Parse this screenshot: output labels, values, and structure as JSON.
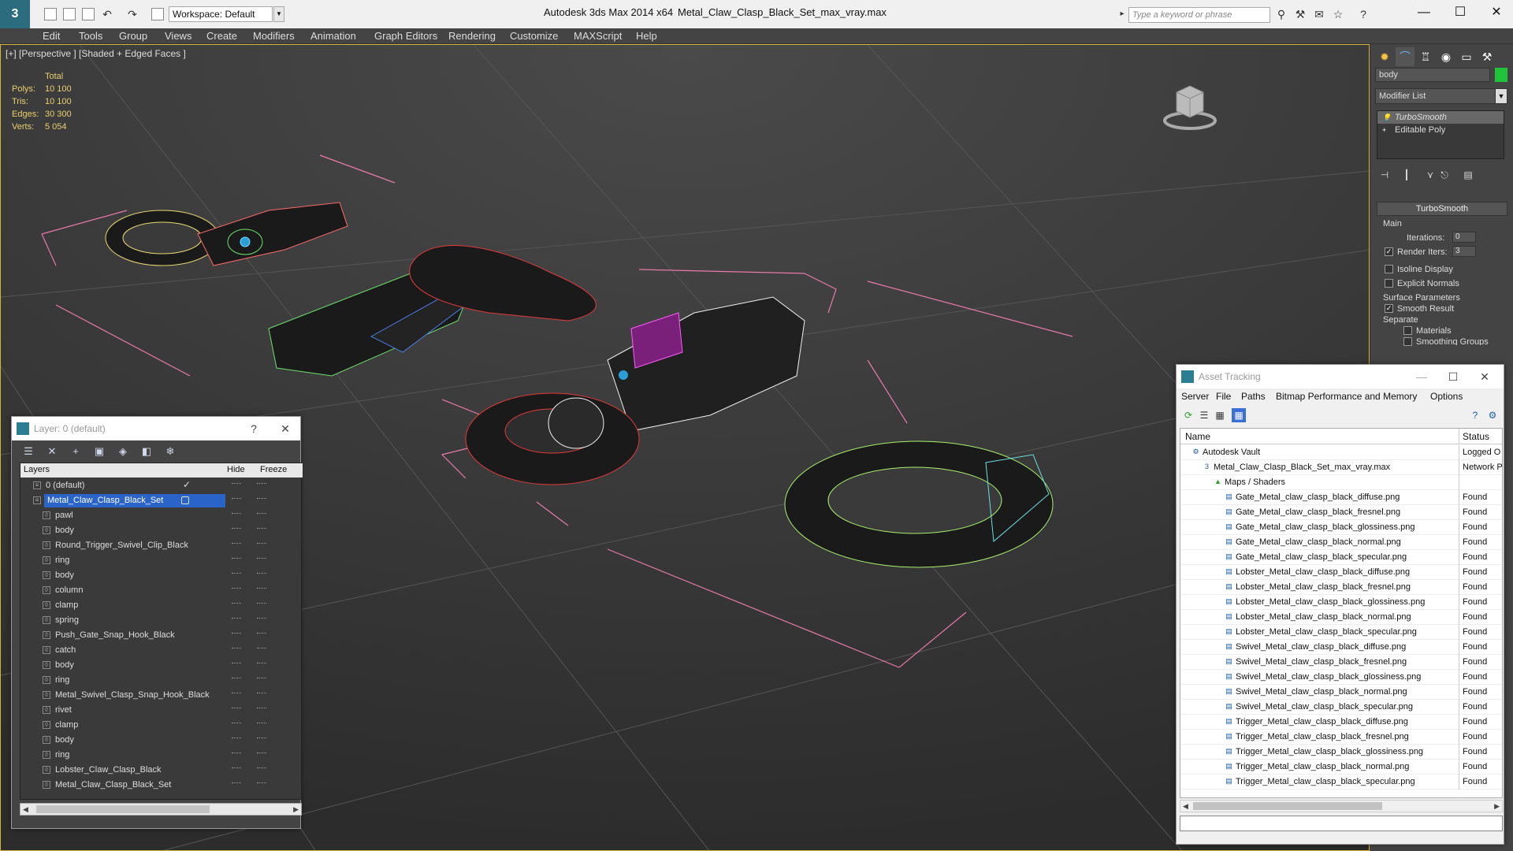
{
  "titlebar": {
    "workspace": "Workspace: Default",
    "app_title": "Autodesk 3ds Max  2014 x64",
    "doc_title": "Metal_Claw_Clasp_Black_Set_max_vray.max",
    "search_placeholder": "Type a keyword or phrase"
  },
  "menu": [
    "Edit",
    "Tools",
    "Group",
    "Views",
    "Create",
    "Modifiers",
    "Animation",
    "Graph Editors",
    "Rendering",
    "Customize",
    "MAXScript",
    "Help"
  ],
  "viewport": {
    "label": "[+] [Perspective ] [Shaded + Edged Faces ]",
    "stats": {
      "header": "Total",
      "polys_label": "Polys:",
      "polys": "10 100",
      "tris_label": "Tris:",
      "tris": "10 100",
      "edges_label": "Edges:",
      "edges": "30 300",
      "verts_label": "Verts:",
      "verts": "5 054"
    }
  },
  "command_panel": {
    "object_name": "body",
    "object_color": "#1fc43a",
    "modifier_list": "Modifier List",
    "stack": [
      "TurboSmooth",
      "Editable Poly"
    ],
    "rollout_title": "TurboSmooth",
    "main_label": "Main",
    "iterations_label": "Iterations:",
    "iterations": "0",
    "render_iters_label": "Render Iters:",
    "render_iters": "3",
    "isoline": "Isoline Display",
    "explicit_normals": "Explicit Normals",
    "surface_params": "Surface Parameters",
    "smooth_result": "Smooth Result",
    "separate": "Separate",
    "materials": "Materials",
    "smoothing_groups": "Smoothing Groups"
  },
  "layers": {
    "title": "Layer: 0 (default)",
    "help": "?",
    "col_layers": "Layers",
    "col_hide": "Hide",
    "col_freeze": "Freeze",
    "rows": [
      {
        "name": "0 (default)",
        "level": 1
      },
      {
        "name": "Metal_Claw_Clasp_Black_Set",
        "level": 1
      },
      {
        "name": "pawl",
        "level": 2
      },
      {
        "name": "body",
        "level": 2
      },
      {
        "name": "Round_Trigger_Swivel_Clip_Black",
        "level": 2
      },
      {
        "name": "ring",
        "level": 2
      },
      {
        "name": "body",
        "level": 2
      },
      {
        "name": "column",
        "level": 2
      },
      {
        "name": "clamp",
        "level": 2
      },
      {
        "name": "spring",
        "level": 2
      },
      {
        "name": "Push_Gate_Snap_Hook_Black",
        "level": 2
      },
      {
        "name": "catch",
        "level": 2
      },
      {
        "name": "body",
        "level": 2
      },
      {
        "name": "ring",
        "level": 2
      },
      {
        "name": "Metal_Swivel_Clasp_Snap_Hook_Black",
        "level": 2
      },
      {
        "name": "rivet",
        "level": 2
      },
      {
        "name": "clamp",
        "level": 2
      },
      {
        "name": "body",
        "level": 2
      },
      {
        "name": "ring",
        "level": 2
      },
      {
        "name": "Lobster_Claw_Clasp_Black",
        "level": 2
      },
      {
        "name": "Metal_Claw_Clasp_Black_Set",
        "level": 2
      }
    ]
  },
  "asset_tracking": {
    "title": "Asset Tracking",
    "menu": [
      "Server",
      "File",
      "Paths",
      "Bitmap Performance and Memory",
      "Options"
    ],
    "col_name": "Name",
    "col_status": "Status",
    "rows": [
      {
        "name": "Autodesk Vault",
        "status": "Logged O",
        "level": 1
      },
      {
        "name": "Metal_Claw_Clasp_Black_Set_max_vray.max",
        "status": "Network P",
        "level": 2
      },
      {
        "name": "Maps / Shaders",
        "status": "",
        "level": 3
      },
      {
        "name": "Gate_Metal_claw_clasp_black_diffuse.png",
        "status": "Found",
        "level": 4
      },
      {
        "name": "Gate_Metal_claw_clasp_black_fresnel.png",
        "status": "Found",
        "level": 4
      },
      {
        "name": "Gate_Metal_claw_clasp_black_glossiness.png",
        "status": "Found",
        "level": 4
      },
      {
        "name": "Gate_Metal_claw_clasp_black_normal.png",
        "status": "Found",
        "level": 4
      },
      {
        "name": "Gate_Metal_claw_clasp_black_specular.png",
        "status": "Found",
        "level": 4
      },
      {
        "name": "Lobster_Metal_claw_clasp_black_diffuse.png",
        "status": "Found",
        "level": 4
      },
      {
        "name": "Lobster_Metal_claw_clasp_black_fresnel.png",
        "status": "Found",
        "level": 4
      },
      {
        "name": "Lobster_Metal_claw_clasp_black_glossiness.png",
        "status": "Found",
        "level": 4
      },
      {
        "name": "Lobster_Metal_claw_clasp_black_normal.png",
        "status": "Found",
        "level": 4
      },
      {
        "name": "Lobster_Metal_claw_clasp_black_specular.png",
        "status": "Found",
        "level": 4
      },
      {
        "name": "Swivel_Metal_claw_clasp_black_diffuse.png",
        "status": "Found",
        "level": 4
      },
      {
        "name": "Swivel_Metal_claw_clasp_black_fresnel.png",
        "status": "Found",
        "level": 4
      },
      {
        "name": "Swivel_Metal_claw_clasp_black_glossiness.png",
        "status": "Found",
        "level": 4
      },
      {
        "name": "Swivel_Metal_claw_clasp_black_normal.png",
        "status": "Found",
        "level": 4
      },
      {
        "name": "Swivel_Metal_claw_clasp_black_specular.png",
        "status": "Found",
        "level": 4
      },
      {
        "name": "Trigger_Metal_claw_clasp_black_diffuse.png",
        "status": "Found",
        "level": 4
      },
      {
        "name": "Trigger_Metal_claw_clasp_black_fresnel.png",
        "status": "Found",
        "level": 4
      },
      {
        "name": "Trigger_Metal_claw_clasp_black_glossiness.png",
        "status": "Found",
        "level": 4
      },
      {
        "name": "Trigger_Metal_claw_clasp_black_normal.png",
        "status": "Found",
        "level": 4
      },
      {
        "name": "Trigger_Metal_claw_clasp_black_specular.png",
        "status": "Found",
        "level": 4
      }
    ]
  }
}
